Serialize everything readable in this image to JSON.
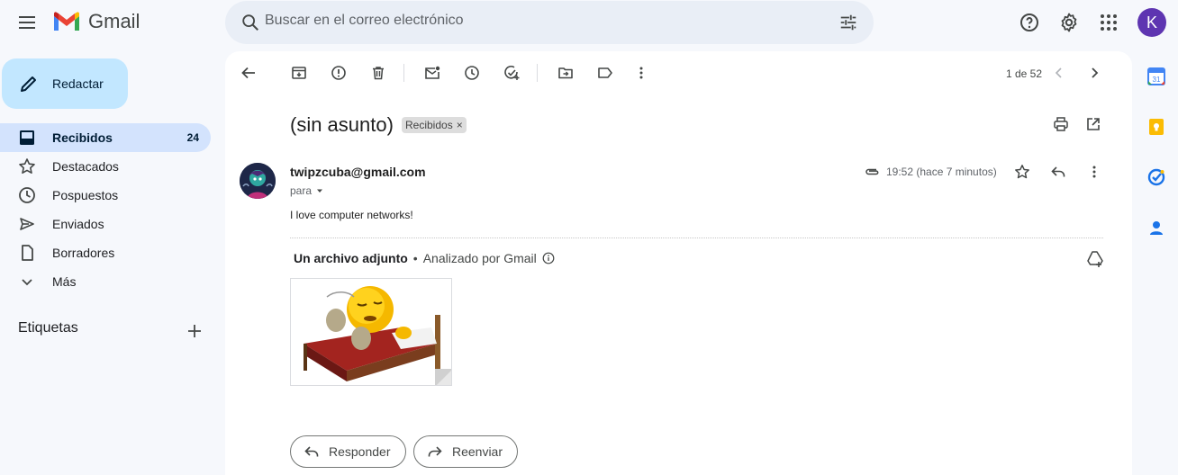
{
  "header": {
    "logo_text": "Gmail",
    "search_placeholder": "Buscar en el correo electrónico",
    "avatar_letter": "K"
  },
  "sidebar": {
    "compose_label": "Redactar",
    "items": [
      {
        "label": "Recibidos",
        "count": "24",
        "icon": "inbox-icon",
        "active": true
      },
      {
        "label": "Destacados",
        "icon": "star-icon"
      },
      {
        "label": "Pospuestos",
        "icon": "clock-icon"
      },
      {
        "label": "Enviados",
        "icon": "send-icon"
      },
      {
        "label": "Borradores",
        "icon": "file-icon"
      },
      {
        "label": "Más",
        "icon": "chevron-down-icon"
      }
    ],
    "labels_title": "Etiquetas"
  },
  "toolbar": {
    "page_count": "1 de 52"
  },
  "message": {
    "subject": "(sin asunto)",
    "label_chip": "Recibidos",
    "label_chip_close": "×",
    "sender": "twipzcuba@gmail.com",
    "to": "para",
    "time": "19:52 (hace 7 minutos)",
    "body": "I love computer networks!",
    "attachment_count": "Un archivo adjunto",
    "attachment_separator": "•",
    "attachment_scan": "Analizado por Gmail"
  },
  "actions": {
    "reply": "Responder",
    "forward": "Reenviar"
  },
  "colors": {
    "accent": "#0b57d0",
    "compose_bg": "#c2e7ff",
    "active_nav": "#d3e3fd",
    "avatar": "#5e35b1"
  }
}
